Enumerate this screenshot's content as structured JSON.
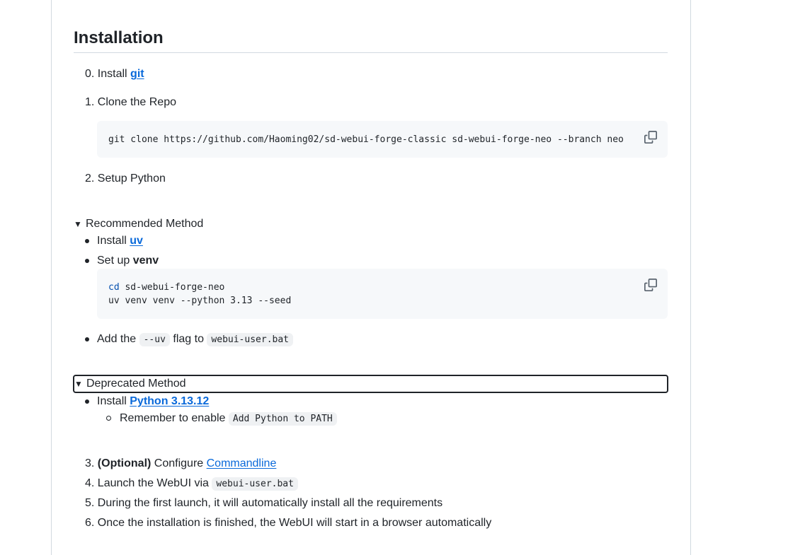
{
  "heading": "Installation",
  "steps": {
    "s0": {
      "num": "0.",
      "text": "Install",
      "link": "git"
    },
    "s1": {
      "num": "1.",
      "text": "Clone the Repo"
    },
    "s1_code": "git clone https://github.com/Haoming02/sd-webui-forge-classic sd-webui-forge-neo --branch neo",
    "s2": {
      "num": "2.",
      "text": "Setup Python"
    }
  },
  "recommended": {
    "summary": "Recommended Method",
    "install_text": "Install",
    "install_link": "uv",
    "setup_text": "Set up",
    "setup_bold": "venv",
    "code_cmd": "cd",
    "code_line1_rest": " sd-webui-forge-neo",
    "code_line2": "uv venv venv --python 3.13 --seed",
    "add_text": "Add the",
    "add_code": "--uv",
    "add_mid": "flag to",
    "add_file": "webui-user.bat"
  },
  "deprecated": {
    "summary": "Deprecated Method",
    "install_text": "Install",
    "install_link": "Python 3.13.12",
    "remember_text": "Remember to enable",
    "remember_code": "Add Python to PATH"
  },
  "later_steps": {
    "s3": {
      "num": "3.",
      "bold": "(Optional)",
      "text": "Configure",
      "link": "Commandline"
    },
    "s4": {
      "num": "4.",
      "text": "Launch the WebUI via",
      "code": "webui-user.bat"
    },
    "s5": {
      "num": "5.",
      "text": "During the first launch, it will automatically install all the requirements"
    },
    "s6": {
      "num": "6.",
      "text": "Once the installation is finished, the WebUI will start in a browser automatically"
    }
  },
  "icons": {
    "copy": "copy-icon",
    "triangle": "triangle-down-icon"
  },
  "colors": {
    "link": "#0969da",
    "text": "#1f2328",
    "code_bg": "#f6f8fa",
    "border": "#d1d9e0"
  }
}
